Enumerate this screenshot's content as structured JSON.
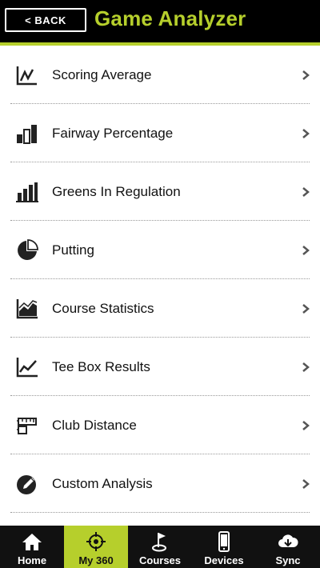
{
  "header": {
    "back_label": "< BACK",
    "title": "Game Analyzer"
  },
  "menu": [
    {
      "label": "Scoring Average",
      "icon": "line-chart-icon"
    },
    {
      "label": "Fairway Percentage",
      "icon": "bar-chart-icon"
    },
    {
      "label": "Greens In Regulation",
      "icon": "bar-chart-rising-icon"
    },
    {
      "label": "Putting",
      "icon": "pie-chart-icon"
    },
    {
      "label": "Course Statistics",
      "icon": "area-chart-icon"
    },
    {
      "label": "Tee Box Results",
      "icon": "trend-chart-icon"
    },
    {
      "label": "Club Distance",
      "icon": "ruler-icon"
    },
    {
      "label": "Custom Analysis",
      "icon": "edit-pen-icon"
    }
  ],
  "tabs": [
    {
      "label": "Home",
      "icon": "home-icon"
    },
    {
      "label": "My 360",
      "icon": "crosshair-icon",
      "active": true
    },
    {
      "label": "Courses",
      "icon": "flag-icon"
    },
    {
      "label": "Devices",
      "icon": "phone-icon"
    },
    {
      "label": "Sync",
      "icon": "cloud-sync-icon"
    }
  ],
  "colors": {
    "accent": "#b6cf2c",
    "header_bg": "#000000",
    "tabbar_bg": "#111111"
  }
}
